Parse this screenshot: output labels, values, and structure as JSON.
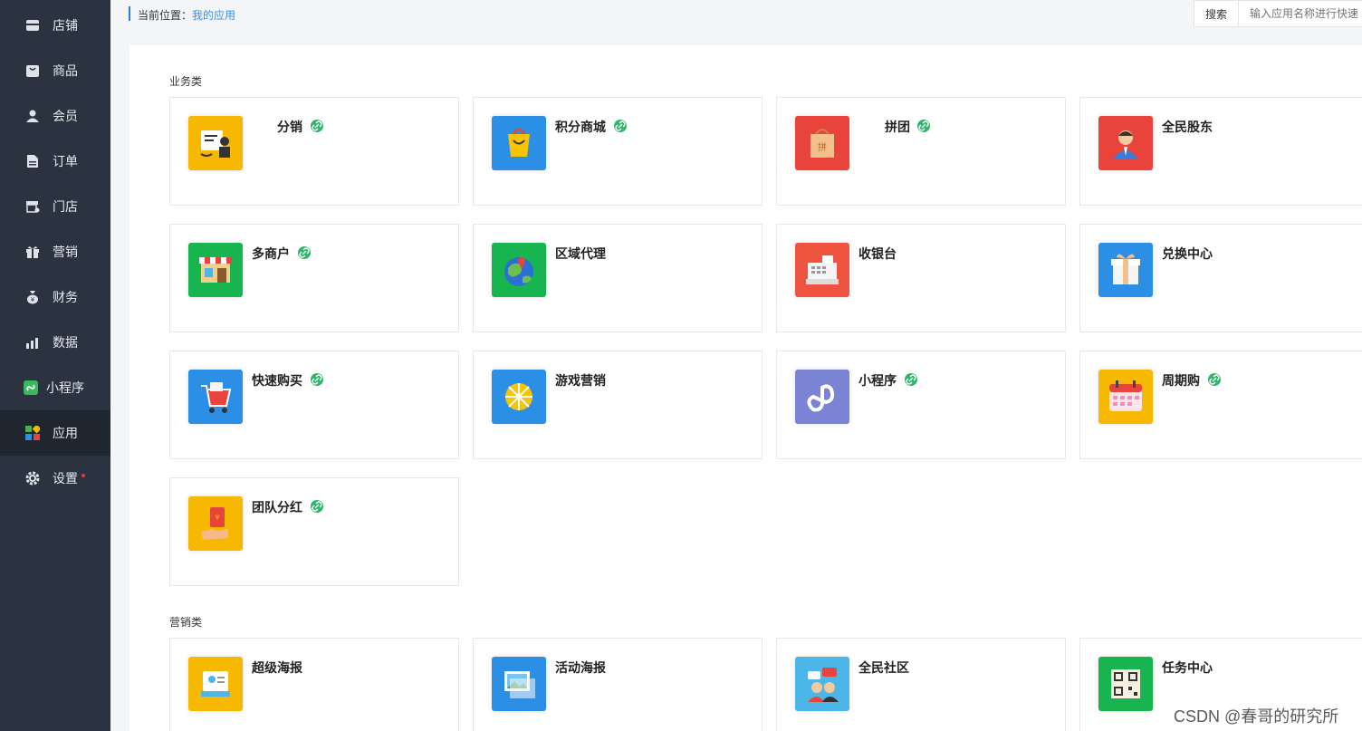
{
  "sidebar": {
    "items": [
      {
        "label": "店铺",
        "icon": "store-icon"
      },
      {
        "label": "商品",
        "icon": "product-icon"
      },
      {
        "label": "会员",
        "icon": "member-icon"
      },
      {
        "label": "订单",
        "icon": "order-icon"
      },
      {
        "label": "门店",
        "icon": "shop-icon"
      },
      {
        "label": "营销",
        "icon": "gift-icon"
      },
      {
        "label": "财务",
        "icon": "money-bag-icon"
      },
      {
        "label": "数据",
        "icon": "chart-icon"
      },
      {
        "label": "小程序",
        "icon": "miniprogram-icon"
      },
      {
        "label": "应用",
        "icon": "apps-icon",
        "active": true
      },
      {
        "label": "设置",
        "icon": "gear-icon",
        "badge": "red-dot"
      }
    ]
  },
  "breadcrumb": {
    "prefix": "当前位置：",
    "current": "我的应用"
  },
  "search": {
    "button": "搜索",
    "placeholder": "输入应用名称进行快速"
  },
  "sections": {
    "business": {
      "title": "业务类",
      "apps": [
        {
          "title": "分销",
          "link": true,
          "color": "#f6b800"
        },
        {
          "title": "积分商城",
          "link": true,
          "color": "#2b8fe6"
        },
        {
          "title": "拼团",
          "link": true,
          "color": "#e8443c"
        },
        {
          "title": "全民股东",
          "link": false,
          "color": "#e8443c"
        },
        {
          "title": "多商户",
          "link": true,
          "color": "#18b450"
        },
        {
          "title": "区域代理",
          "link": false,
          "color": "#18b450"
        },
        {
          "title": "收银台",
          "link": false,
          "color": "#ef5440"
        },
        {
          "title": "兑换中心",
          "link": false,
          "color": "#2b8fe6"
        },
        {
          "title": "快速购买",
          "link": true,
          "color": "#2b8fe6"
        },
        {
          "title": "游戏营销",
          "link": false,
          "color": "#2b8fe6"
        },
        {
          "title": "小程序",
          "link": true,
          "color": "#7b83d4"
        },
        {
          "title": "周期购",
          "link": true,
          "color": "#f6b800"
        },
        {
          "title": "团队分红",
          "link": true,
          "color": "#f6b800"
        }
      ]
    },
    "marketing": {
      "title": "营销类",
      "apps": [
        {
          "title": "超级海报",
          "link": false,
          "color": "#f6b800"
        },
        {
          "title": "活动海报",
          "link": false,
          "color": "#2b8fe6"
        },
        {
          "title": "全民社区",
          "link": false,
          "color": "#4db6e8"
        },
        {
          "title": "任务中心",
          "link": false,
          "color": "#18b450"
        }
      ]
    }
  },
  "watermark": "CSDN @春哥的研究所"
}
